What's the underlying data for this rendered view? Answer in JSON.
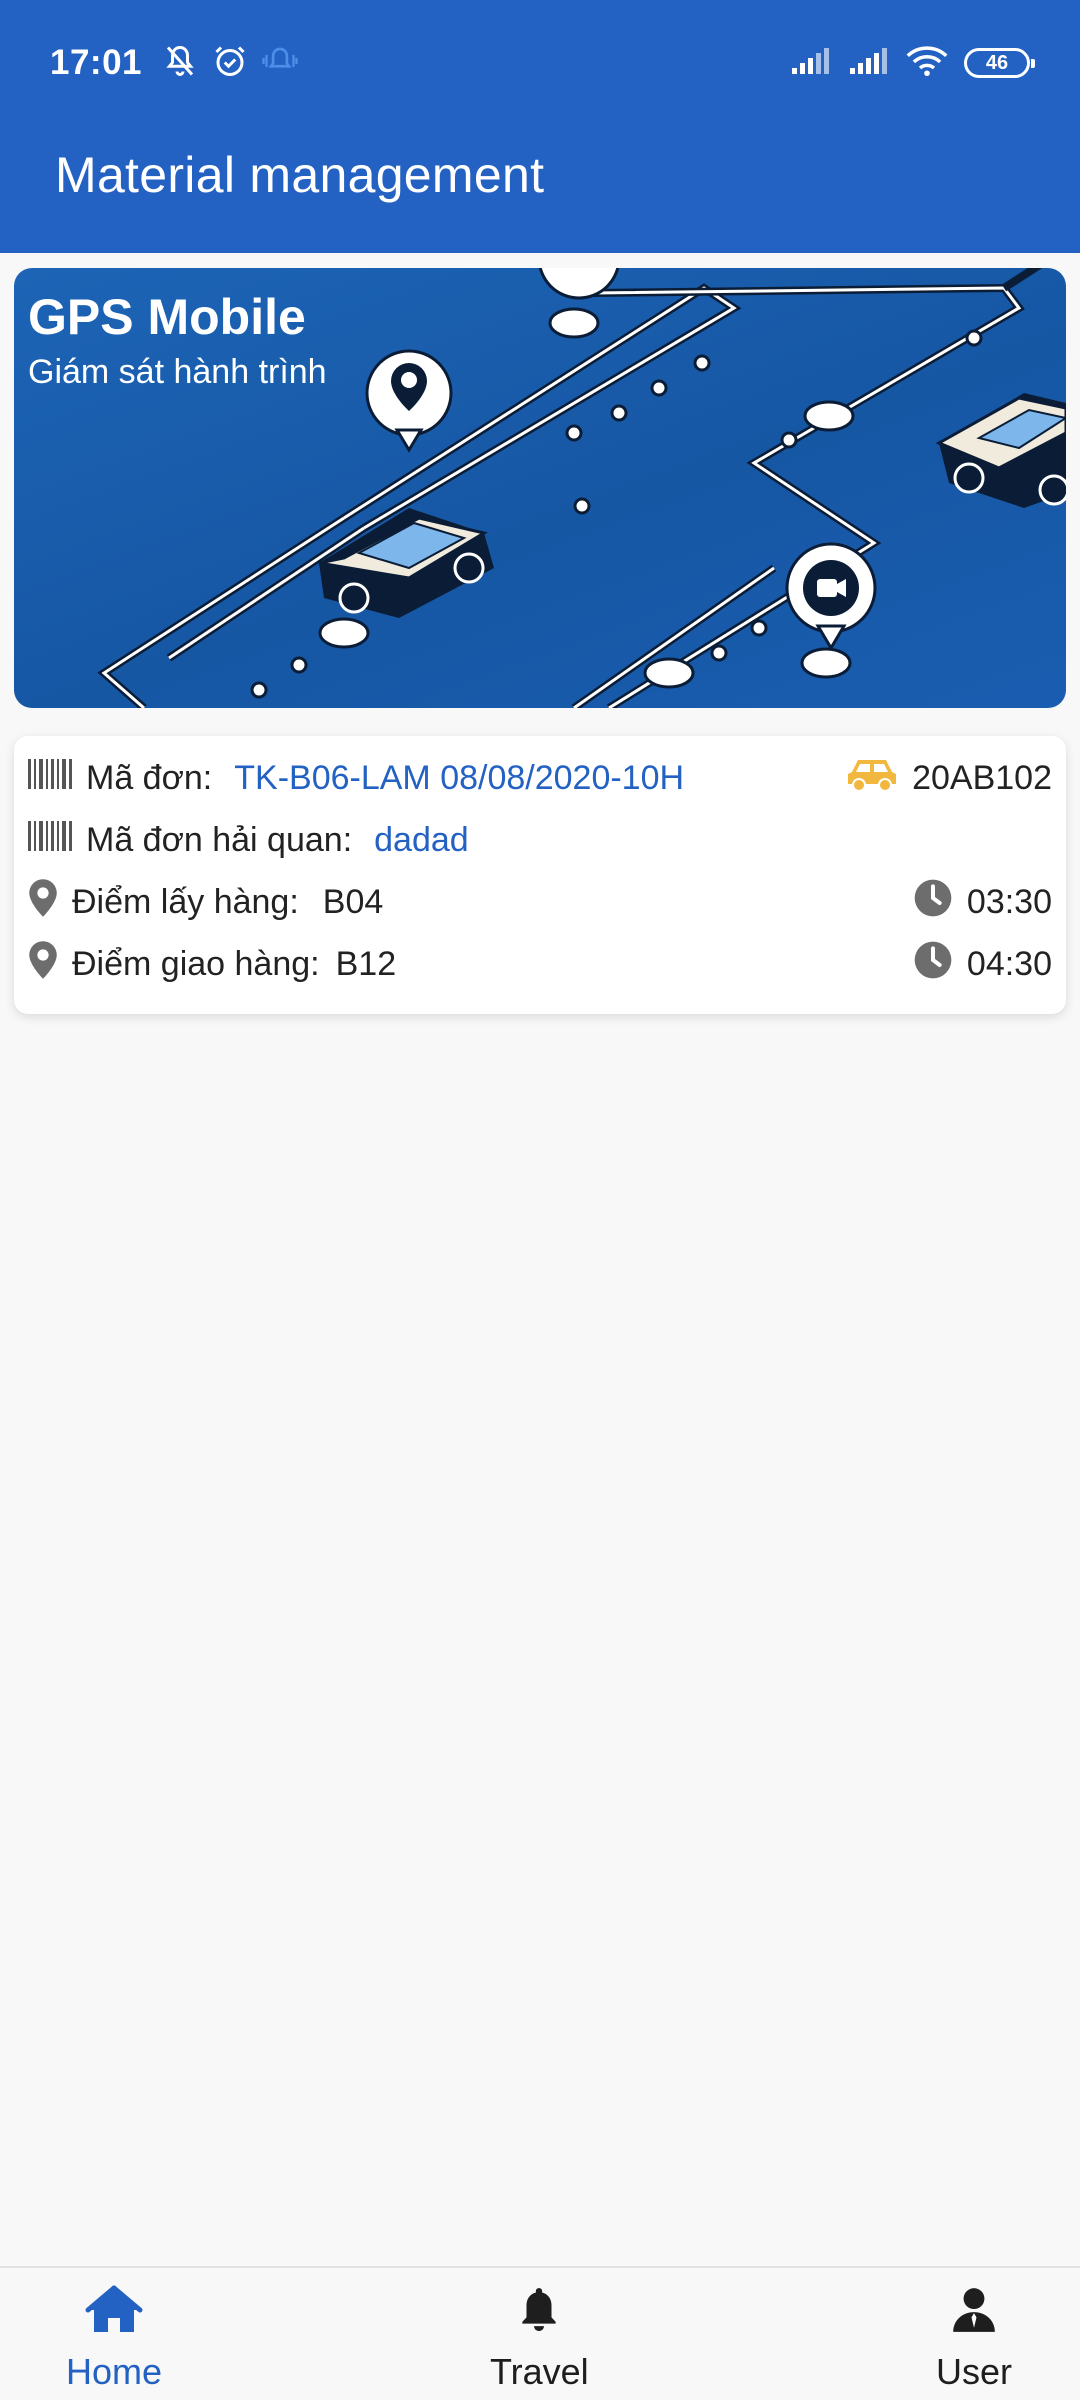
{
  "status_bar": {
    "time": "17:01",
    "battery": "46",
    "icons": [
      "mute-bell-icon",
      "alarm-icon",
      "vibrate-icon",
      "signal-icon",
      "signal-icon",
      "wifi-icon",
      "battery-icon"
    ]
  },
  "app_bar": {
    "title": "Material management"
  },
  "banner": {
    "title": "GPS Mobile",
    "subtitle": "Giám sát hành trình"
  },
  "order": {
    "order_code_label": "Mã đơn:",
    "order_code": "TK-B06-LAM 08/08/2020-10H",
    "vehicle_plate": "20AB102",
    "customs_code_label": "Mã đơn hải quan:",
    "customs_code": "dadad",
    "pickup_label": "Điểm lấy hàng:",
    "pickup_point": "B04",
    "pickup_time": "03:30",
    "delivery_label": "Điểm giao hàng:",
    "delivery_point": "B12",
    "delivery_time": "04:30"
  },
  "bottom_nav": {
    "items": [
      {
        "label": "Home",
        "icon": "home-icon",
        "active": true
      },
      {
        "label": "Travel",
        "icon": "bell-icon",
        "active": false
      },
      {
        "label": "User",
        "icon": "user-icon",
        "active": false
      }
    ]
  },
  "colors": {
    "primary": "#2361c3",
    "link": "#2361c3",
    "car_icon": "#f2b73f",
    "icon_gray": "#6d6d6d",
    "background": "#f8f8f8"
  }
}
